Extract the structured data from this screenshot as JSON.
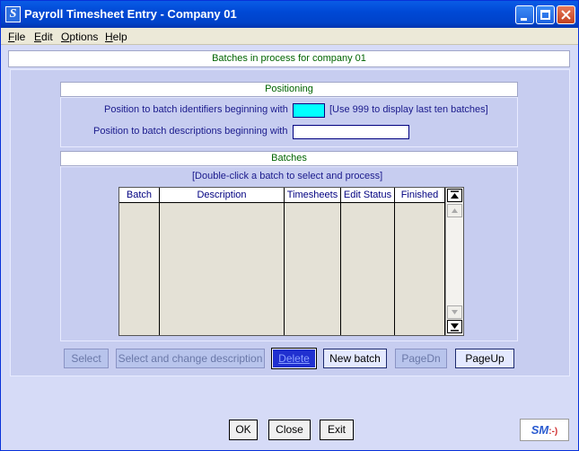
{
  "window": {
    "title": "Payroll Timesheet Entry - Company 01",
    "app_icon_glyph": "S"
  },
  "menu": [
    {
      "key": "F",
      "rest": "ile"
    },
    {
      "key": "E",
      "rest": "dit"
    },
    {
      "key": "O",
      "rest": "ptions"
    },
    {
      "key": "H",
      "rest": "elp"
    }
  ],
  "header": "Batches in process for company 01",
  "positioning": {
    "title": "Positioning",
    "id_label": "Position to batch identifiers beginning with",
    "id_value": "",
    "id_hint": "[Use 999 to display last ten batches]",
    "desc_label": "Position to batch descriptions beginning with",
    "desc_value": ""
  },
  "batches": {
    "title": "Batches",
    "hint": "[Double-click a batch to select and process]",
    "columns": [
      "Batch",
      "Description",
      "Timesheets",
      "Edit Status",
      "Finished"
    ],
    "rows": []
  },
  "actions": {
    "select": "Select",
    "select_change": "Select and change description",
    "delete": "Delete",
    "new_batch": "New batch",
    "page_dn": "PageDn",
    "page_up": "PageUp"
  },
  "footer": {
    "ok": "OK",
    "close": "Close",
    "exit": "Exit",
    "logo": "SM"
  },
  "colors": {
    "titlebar": "#0049d6",
    "panel": "#c7cdf0",
    "group_title_text": "#006400",
    "label_text": "#1a1a8c"
  }
}
